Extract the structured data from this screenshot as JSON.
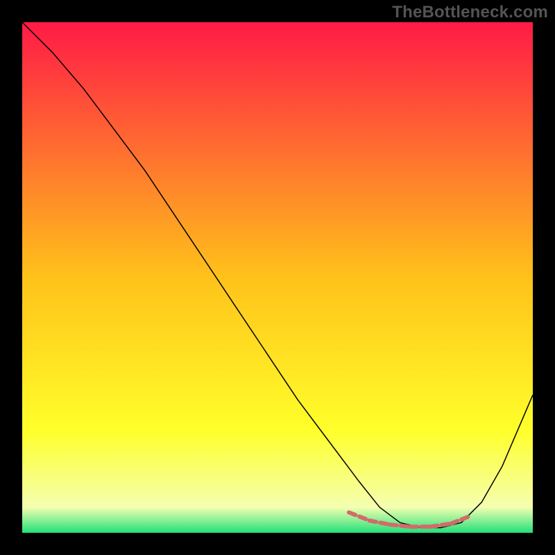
{
  "watermark": "TheBottleneck.com",
  "chart_data": {
    "type": "line",
    "title": "",
    "xlabel": "",
    "ylabel": "",
    "xlim": [
      0,
      100
    ],
    "ylim": [
      0,
      100
    ],
    "grid": false,
    "background_gradient": {
      "stops": [
        {
          "offset": 0.0,
          "color": "#ff1a46"
        },
        {
          "offset": 0.5,
          "color": "#ffc21a"
        },
        {
          "offset": 0.8,
          "color": "#ffff2a"
        },
        {
          "offset": 0.95,
          "color": "#f4ffb0"
        },
        {
          "offset": 1.0,
          "color": "#22e07a"
        }
      ]
    },
    "series": [
      {
        "name": "curve",
        "color": "#000000",
        "width": 1.5,
        "x": [
          0,
          6,
          12,
          18,
          24,
          30,
          36,
          42,
          48,
          54,
          60,
          66,
          70,
          74,
          78,
          82,
          86,
          90,
          94,
          100
        ],
        "y": [
          100,
          94,
          87,
          79,
          71,
          62,
          53,
          44,
          35,
          26,
          18,
          10,
          5,
          2,
          1,
          1,
          2,
          6,
          13,
          27
        ]
      },
      {
        "name": "bottom-highlight",
        "color": "#d46a6a",
        "width": 6,
        "style": "dashed",
        "x": [
          64,
          68,
          72,
          76,
          80,
          84,
          88
        ],
        "y": [
          4.0,
          2.4,
          1.6,
          1.2,
          1.2,
          1.8,
          3.4
        ]
      }
    ]
  }
}
